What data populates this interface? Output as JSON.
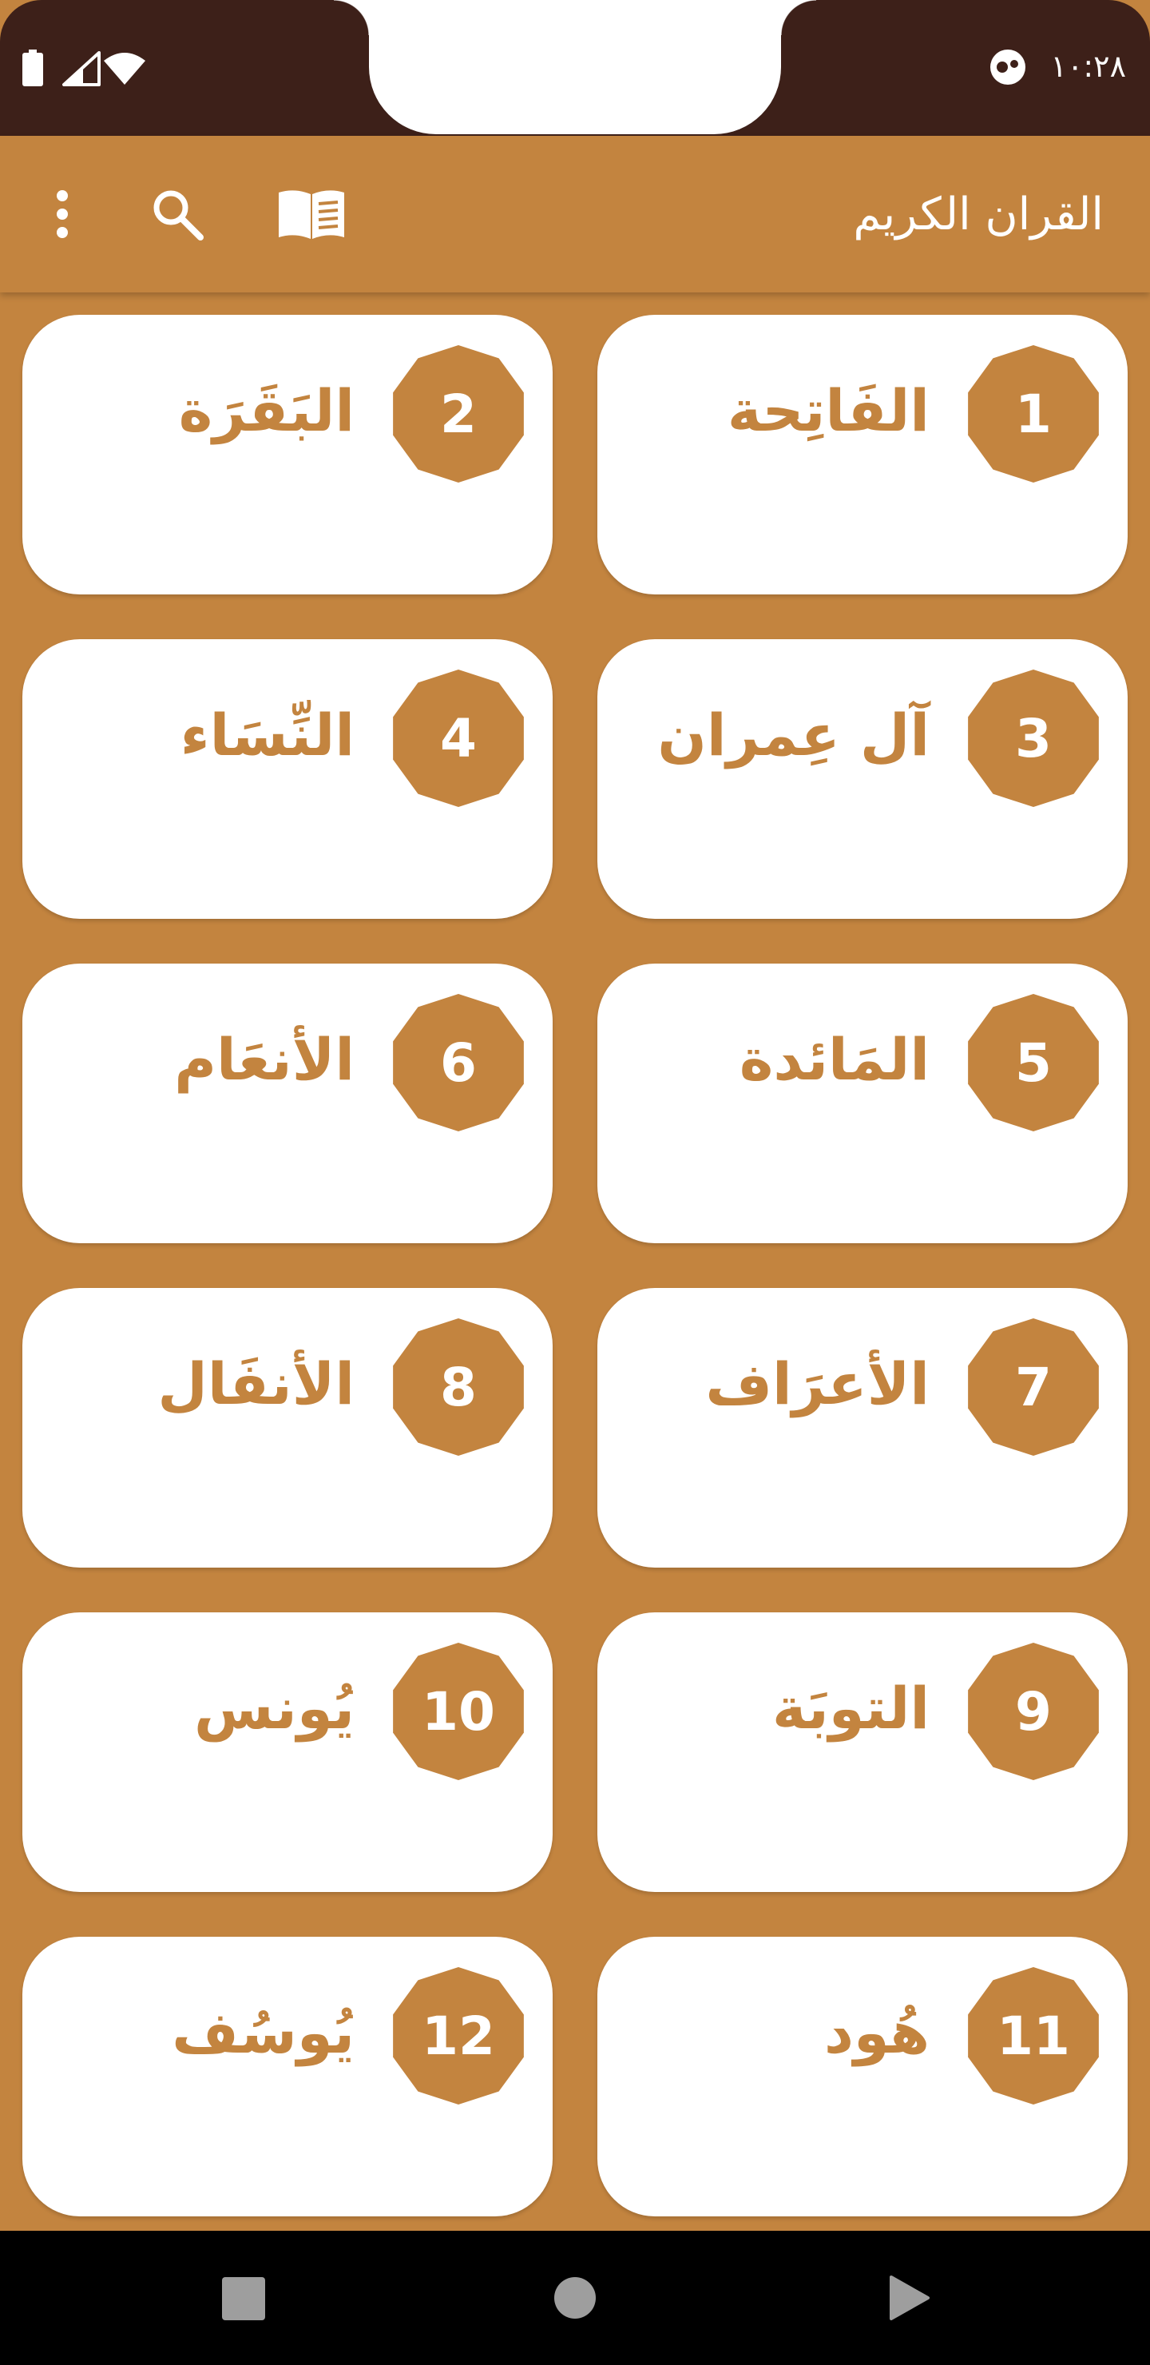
{
  "status_bar": {
    "time": "١٠:٢٨",
    "icons": [
      "battery-icon",
      "signal-icon",
      "wifi-icon",
      "do-not-disturb-icon"
    ]
  },
  "app_bar": {
    "title": "القران الكريم",
    "actions": [
      "book-icon",
      "search-icon",
      "more-vert-icon"
    ]
  },
  "surahs": [
    {
      "number": "1",
      "name": "الفَاتِحة"
    },
    {
      "number": "2",
      "name": "البَقَرَة"
    },
    {
      "number": "3",
      "name": "آل عِمران"
    },
    {
      "number": "4",
      "name": "النِّسَاء"
    },
    {
      "number": "5",
      "name": "المَائدة"
    },
    {
      "number": "6",
      "name": "الأنعَام"
    },
    {
      "number": "7",
      "name": "الأعرَاف"
    },
    {
      "number": "8",
      "name": "الأنفَال"
    },
    {
      "number": "9",
      "name": "التوبَة"
    },
    {
      "number": "10",
      "name": "يُونس"
    },
    {
      "number": "11",
      "name": "هُود"
    },
    {
      "number": "12",
      "name": "يُوسُف"
    }
  ],
  "navigation_bar": {
    "buttons": [
      "recents-button",
      "home-button",
      "back-button"
    ]
  },
  "colors": {
    "primary": "#C3843F",
    "status_bar": "#3D2019",
    "card": "#FFFFFF",
    "nav_bar": "#000000"
  }
}
